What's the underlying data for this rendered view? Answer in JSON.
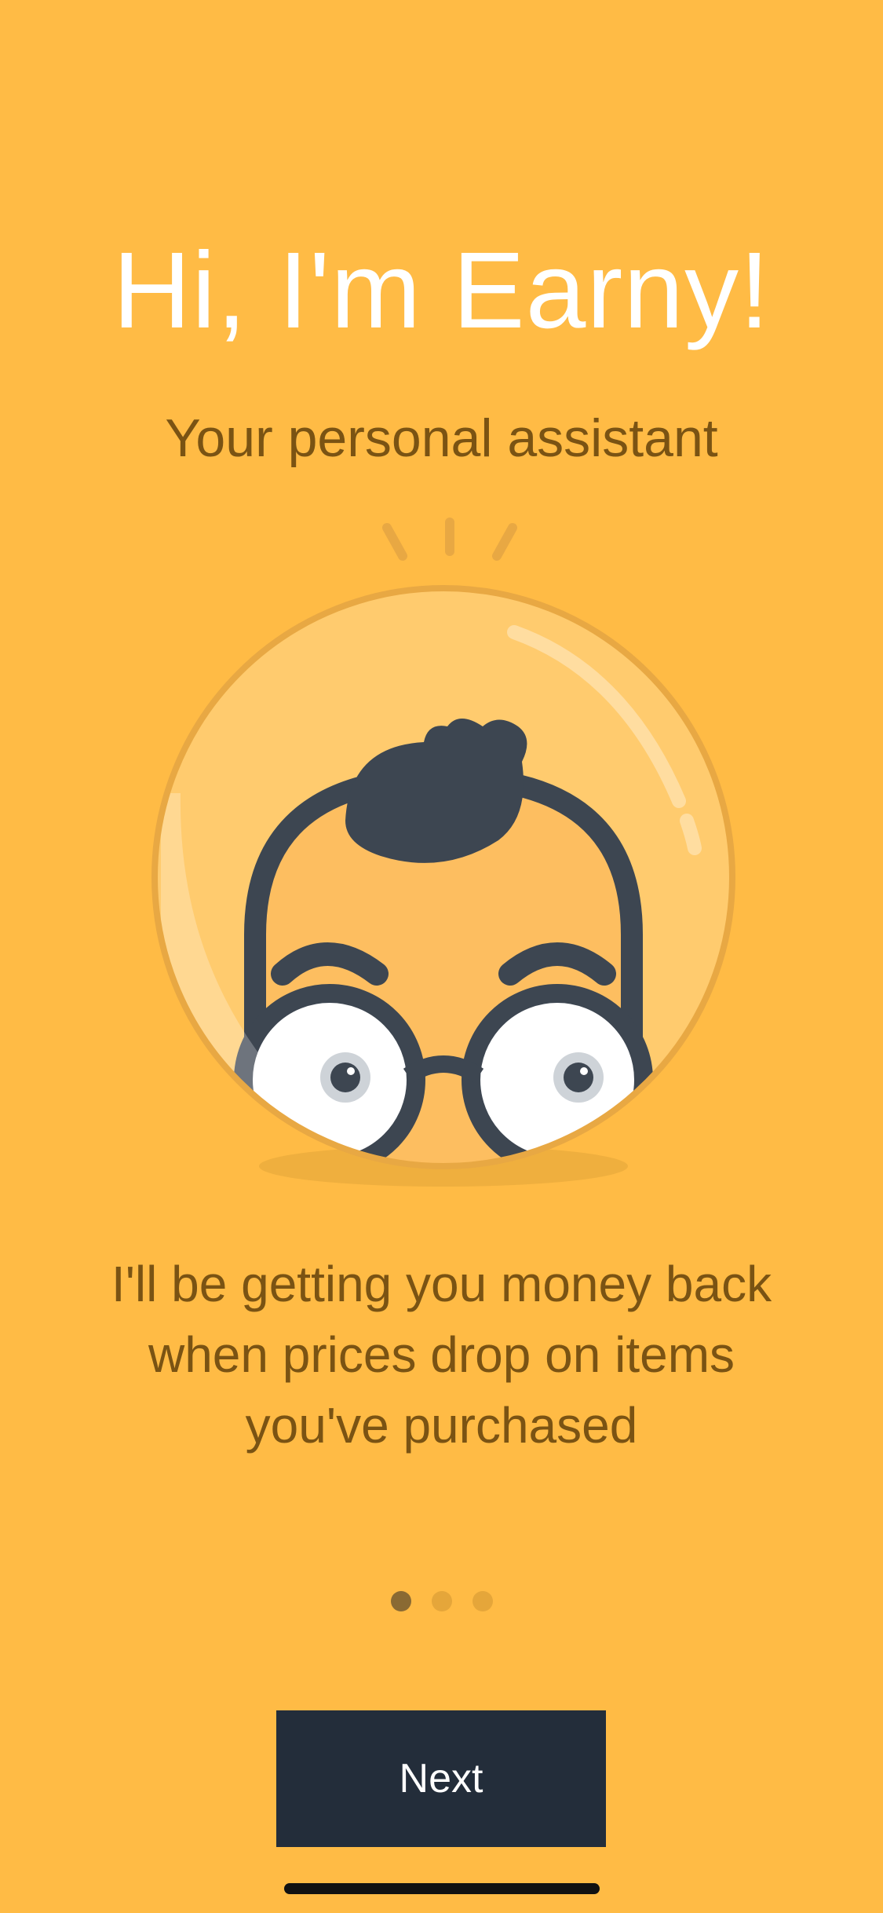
{
  "onboarding": {
    "title": "Hi, I'm Earny!",
    "subtitle": "Your personal assistant",
    "description": "I'll be getting you money back when prices drop on items you've purchased",
    "page_indicator": {
      "current": 1,
      "total": 3
    },
    "next_label": "Next"
  },
  "colors": {
    "background": "#FFBB45",
    "button": "#232D3A",
    "text_dark": "#7A5313",
    "title": "#FFFFFF"
  },
  "icons": {
    "mascot": "earny-mascot-icon",
    "dot": "page-dot"
  }
}
